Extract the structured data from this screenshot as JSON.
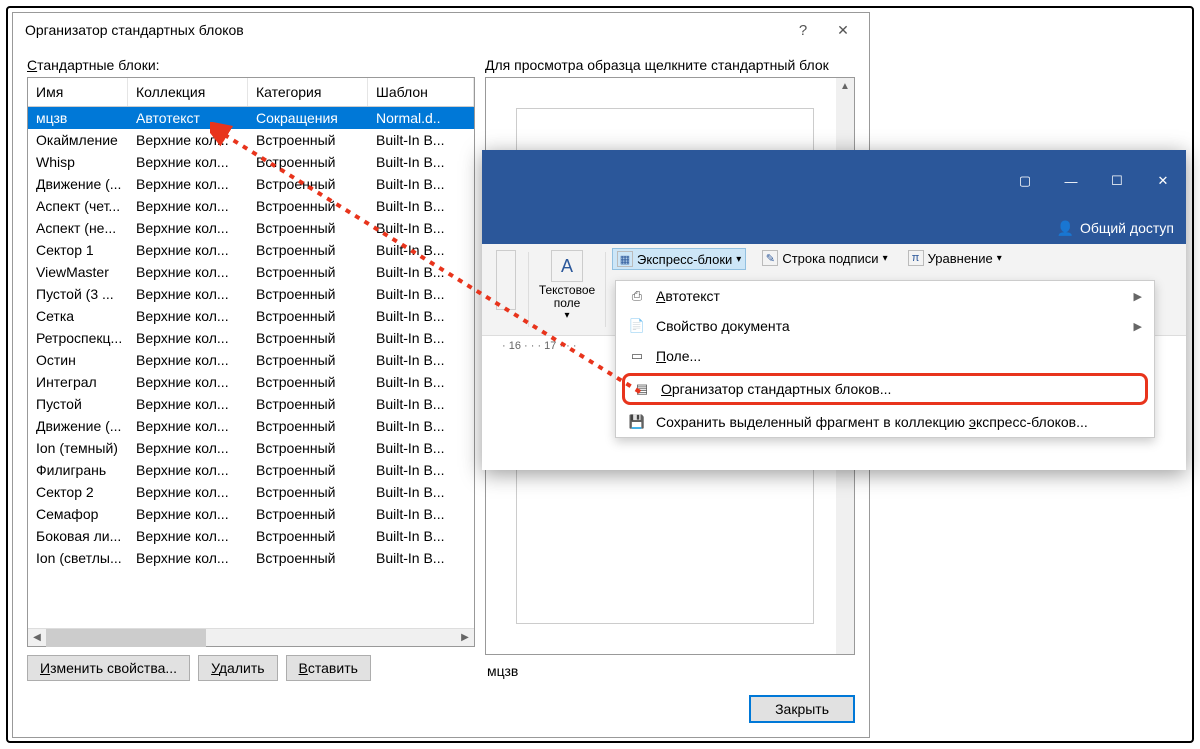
{
  "dialog": {
    "title": "Организатор стандартных блоков",
    "left_label": "Стандартные блоки:",
    "right_label": "Для просмотра образца щелкните стандартный блок",
    "columns": {
      "name": "Имя",
      "collection": "Коллекция",
      "category": "Категория",
      "template": "Шаблон"
    },
    "rows": [
      {
        "name": "мцзв",
        "coll": "Автотекст",
        "cat": "Сокращения",
        "tmpl": "Normal.d..",
        "sel": true
      },
      {
        "name": "Окаймление",
        "coll": "Верхние кол...",
        "cat": "Встроенный",
        "tmpl": "Built-In B..."
      },
      {
        "name": "Whisp",
        "coll": "Верхние кол...",
        "cat": "Встроенный",
        "tmpl": "Built-In B..."
      },
      {
        "name": "Движение (...",
        "coll": "Верхние кол...",
        "cat": "Встроенный",
        "tmpl": "Built-In B..."
      },
      {
        "name": "Аспект (чет...",
        "coll": "Верхние кол...",
        "cat": "Встроенный",
        "tmpl": "Built-In B..."
      },
      {
        "name": "Аспект (не...",
        "coll": "Верхние кол...",
        "cat": "Встроенный",
        "tmpl": "Built-In B..."
      },
      {
        "name": "Сектор 1",
        "coll": "Верхние кол...",
        "cat": "Встроенный",
        "tmpl": "Built-In B..."
      },
      {
        "name": "ViewMaster",
        "coll": "Верхние кол...",
        "cat": "Встроенный",
        "tmpl": "Built-In B..."
      },
      {
        "name": " Пустой (3 ...",
        "coll": "Верхние кол...",
        "cat": "Встроенный",
        "tmpl": "Built-In B..."
      },
      {
        "name": "Сетка",
        "coll": "Верхние кол...",
        "cat": "Встроенный",
        "tmpl": "Built-In B..."
      },
      {
        "name": "Ретроспекц...",
        "coll": "Верхние кол...",
        "cat": "Встроенный",
        "tmpl": "Built-In B..."
      },
      {
        "name": "Остин",
        "coll": "Верхние кол...",
        "cat": "Встроенный",
        "tmpl": "Built-In B..."
      },
      {
        "name": "Интеграл",
        "coll": "Верхние кол...",
        "cat": "Встроенный",
        "tmpl": "Built-In B..."
      },
      {
        "name": " Пустой",
        "coll": "Верхние кол...",
        "cat": "Встроенный",
        "tmpl": "Built-In B..."
      },
      {
        "name": "Движение (...",
        "coll": "Верхние кол...",
        "cat": "Встроенный",
        "tmpl": "Built-In B..."
      },
      {
        "name": "Ion (темный)",
        "coll": "Верхние кол...",
        "cat": "Встроенный",
        "tmpl": "Built-In B..."
      },
      {
        "name": "Филигрань",
        "coll": "Верхние кол...",
        "cat": "Встроенный",
        "tmpl": "Built-In B..."
      },
      {
        "name": "Сектор 2",
        "coll": "Верхние кол...",
        "cat": "Встроенный",
        "tmpl": "Built-In B..."
      },
      {
        "name": "Семафор",
        "coll": "Верхние кол...",
        "cat": "Встроенный",
        "tmpl": "Built-In B..."
      },
      {
        "name": "Боковая ли...",
        "coll": "Верхние кол...",
        "cat": "Встроенный",
        "tmpl": "Built-In B..."
      },
      {
        "name": "Ion (светлы...",
        "coll": "Верхние кол...",
        "cat": "Встроенный",
        "tmpl": "Built-In B..."
      }
    ],
    "preview_name": "мцзв",
    "buttons": {
      "props": "Изменить свойства...",
      "delete": "Удалить",
      "insert": "Вставить",
      "close": "Закрыть"
    }
  },
  "word": {
    "share": "Общий доступ",
    "textbox": "Текстовое поле",
    "quick_parts": "Экспресс-блоки",
    "sig_line": "Строка подписи",
    "equation": "Уравнение",
    "ruler": "· 16 · · · 17 · · ·",
    "dropdown": {
      "autotext": "Автотекст",
      "docprop": "Свойство документа",
      "field": "Поле...",
      "organizer": "Организатор стандартных блоков...",
      "save": "Сохранить выделенный фрагмент в коллекцию экспресс-блоков..."
    }
  }
}
